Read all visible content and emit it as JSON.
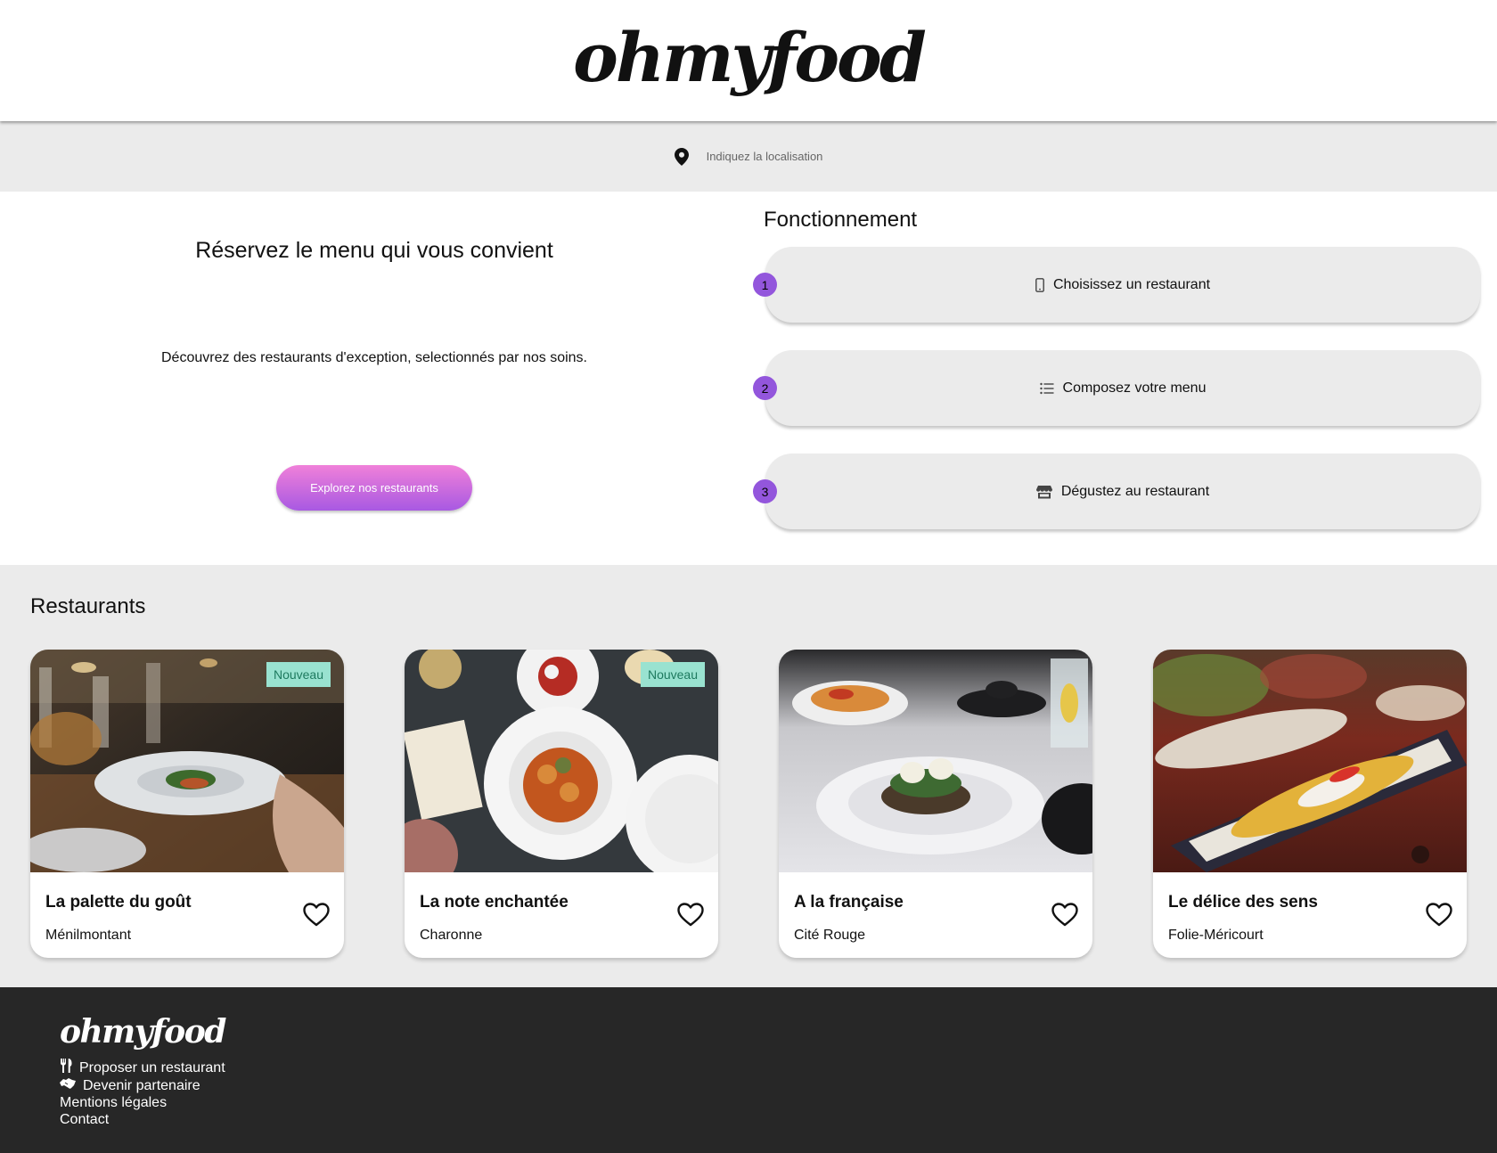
{
  "header": {
    "logo": "ohmyfood"
  },
  "location": {
    "placeholder": "Indiquez la localisation",
    "icon": "map-pin-icon"
  },
  "hero": {
    "title": "Réservez le menu qui vous convient",
    "subtitle": "Découvrez des restaurants d'exception, selectionnés par nos soins.",
    "button_label": "Explorez nos restaurants",
    "button_gradient": [
      "#f080d9",
      "#a859e2"
    ]
  },
  "how": {
    "title": "Fonctionnement",
    "steps": [
      {
        "number": "1",
        "label": "Choisissez un restaurant",
        "icon": "mobile-phone-icon"
      },
      {
        "number": "2",
        "label": "Composez votre menu",
        "icon": "list-icon"
      },
      {
        "number": "3",
        "label": "Dégustez au restaurant",
        "icon": "store-icon"
      }
    ],
    "number_color": "#9356dc"
  },
  "restaurants": {
    "title": "Restaurants",
    "items": [
      {
        "name": "La palette du goût",
        "place": "Ménilmontant",
        "badge": "Nouveau"
      },
      {
        "name": "La note enchantée",
        "place": "Charonne",
        "badge": "Nouveau"
      },
      {
        "name": "A la française",
        "place": "Cité Rouge",
        "badge": ""
      },
      {
        "name": "Le délice des sens",
        "place": "Folie-Méricourt",
        "badge": ""
      }
    ],
    "badge_color": "#99e2d0"
  },
  "footer": {
    "logo": "ohmyfood",
    "links": [
      {
        "label": "Proposer un restaurant",
        "icon": "utensils-icon"
      },
      {
        "label": "Devenir partenaire",
        "icon": "handshake-icon"
      },
      {
        "label": "Mentions légales",
        "icon": ""
      },
      {
        "label": "Contact",
        "icon": ""
      }
    ]
  }
}
